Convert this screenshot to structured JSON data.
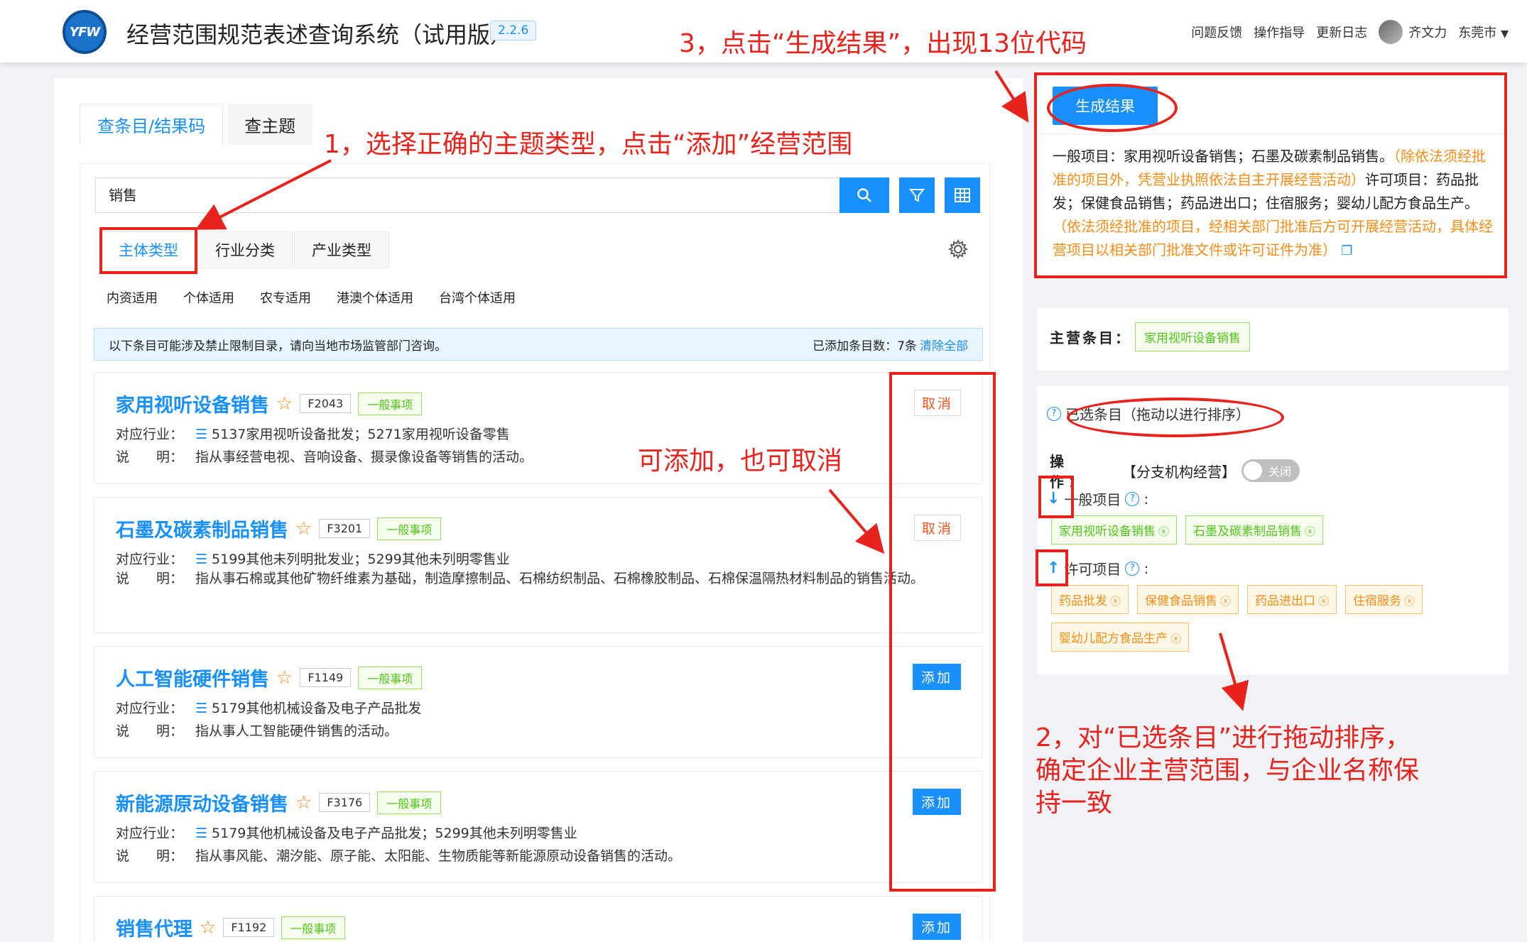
{
  "header": {
    "logo": "YFW",
    "title": "经营范围规范表述查询系统（试用版）",
    "version": "2.2.6",
    "links": [
      "问题反馈",
      "操作指导",
      "更新日志"
    ],
    "user": "齐文力",
    "city": "东莞市"
  },
  "left": {
    "tabs": [
      "查条目/结果码",
      "查主题"
    ],
    "search": {
      "value": "销售"
    },
    "subtabs": [
      "主体类型",
      "行业分类",
      "产业类型"
    ],
    "chips": [
      "内资适用",
      "个体适用",
      "农专适用",
      "港澳个体适用",
      "台湾个体适用"
    ],
    "notice": {
      "text": "以下条目可能涉及禁止限制目录，请向当地市场监管部门咨询。",
      "count_label": "已添加条目数：7条",
      "clear": "清除全部"
    },
    "labels": {
      "industry": "对应行业：",
      "desc": "说　　明："
    },
    "items": [
      {
        "name": "家用视听设备销售",
        "code": "F2043",
        "type": "一般事项",
        "industry": "5137家用视听设备批发；5271家用视听设备零售",
        "desc": "指从事经营电视、音响设备、摄录像设备等销售的活动。",
        "action": "取消"
      },
      {
        "name": "石墨及碳素制品销售",
        "code": "F3201",
        "type": "一般事项",
        "industry": "5199其他未列明批发业；5299其他未列明零售业",
        "desc": "指从事石棉或其他矿物纤维素为基础，制造摩擦制品、石棉纺织制品、石棉橡胶制品、石棉保温隔热材料制品的销售活动。",
        "action": "取消"
      },
      {
        "name": "人工智能硬件销售",
        "code": "F1149",
        "type": "一般事项",
        "industry": "5179其他机械设备及电子产品批发",
        "desc": "指从事人工智能硬件销售的活动。",
        "action": "添加"
      },
      {
        "name": "新能源原动设备销售",
        "code": "F3176",
        "type": "一般事项",
        "industry": "5179其他机械设备及电子产品批发；5299其他未列明零售业",
        "desc": "指从事风能、潮汐能、原子能、太阳能、生物质能等新能源原动设备销售的活动。",
        "action": "添加"
      },
      {
        "name": "销售代理",
        "code": "F1192",
        "type": "一般事项",
        "action": "添加"
      }
    ]
  },
  "right": {
    "generate_label": "生成结果",
    "result": {
      "general": "一般项目：家用视听设备销售；石墨及碳素制品销售。",
      "general_note": "（除依法须经批准的项目外，凭营业执照依法自主开展经营活动）",
      "permit": "许可项目：药品批发；保健食品销售；药品进出口；住宿服务；婴幼儿配方食品生产。",
      "permit_note": "（依法须经批准的项目，经相关部门批准后方可开展经营活动，具体经营项目以相关部门批准文件或许可证件为准）"
    },
    "main_label": "主营条目：",
    "main_item": "家用视听设备销售",
    "selected_title": "已选条目（拖动以进行排序）",
    "op_label": "操　作：",
    "op_branch": "【分支机构经营】",
    "toggle_off": "关闭",
    "general_label": "一般项目",
    "general_items": [
      "家用视听设备销售",
      "石墨及碳素制品销售"
    ],
    "permit_label": "许可项目",
    "permit_items": [
      "药品批发",
      "保健食品销售",
      "药品进出口",
      "住宿服务",
      "婴幼儿配方食品生产"
    ]
  },
  "annotations": {
    "step1": "1，选择正确的主题类型，点击“添加”经营范围",
    "step2_line1": "2，对“已选条目”进行拖动排序，",
    "step2_line2": "确定企业主营范围，与企业名称保",
    "step2_line3": "持一致",
    "step3": "3，点击“生成结果”，出现13位代码",
    "add_cancel": "可添加，也可取消",
    "color": "#e8231d"
  }
}
